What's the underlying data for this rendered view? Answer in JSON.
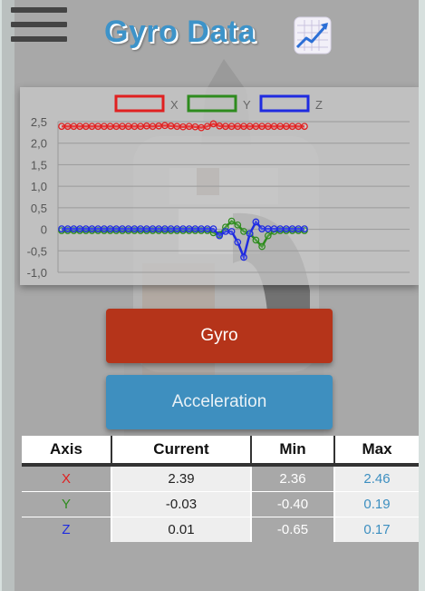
{
  "header": {
    "title": "Gyro Data",
    "menu_icon": "hamburger-menu-icon",
    "title_icon": "chart-increasing-icon"
  },
  "chart_data": {
    "type": "line",
    "x": [
      1,
      2,
      3,
      4,
      5,
      6,
      7,
      8,
      9,
      10,
      11,
      12,
      13,
      14,
      15,
      16,
      17,
      18,
      19,
      20,
      21,
      22,
      23,
      24,
      25,
      26,
      27,
      28,
      29,
      30,
      31,
      32,
      33,
      34,
      35,
      36,
      37,
      38,
      39,
      40,
      41
    ],
    "series": [
      {
        "name": "X",
        "color": "#e02020",
        "values": [
          2.39,
          2.39,
          2.39,
          2.39,
          2.39,
          2.39,
          2.39,
          2.39,
          2.39,
          2.39,
          2.39,
          2.39,
          2.39,
          2.39,
          2.4,
          2.39,
          2.4,
          2.41,
          2.4,
          2.39,
          2.38,
          2.39,
          2.38,
          2.36,
          2.39,
          2.45,
          2.4,
          2.39,
          2.39,
          2.39,
          2.39,
          2.39,
          2.39,
          2.39,
          2.39,
          2.39,
          2.39,
          2.39,
          2.39,
          2.39,
          2.39
        ]
      },
      {
        "name": "Y",
        "color": "#2e8b1e",
        "values": [
          -0.03,
          -0.03,
          -0.03,
          -0.03,
          -0.03,
          -0.03,
          -0.03,
          -0.03,
          -0.03,
          -0.03,
          -0.03,
          -0.03,
          -0.03,
          -0.03,
          -0.03,
          -0.03,
          -0.03,
          -0.03,
          -0.03,
          -0.03,
          -0.03,
          -0.03,
          -0.03,
          -0.03,
          -0.03,
          -0.08,
          -0.12,
          0.05,
          0.19,
          0.1,
          -0.05,
          -0.1,
          -0.25,
          -0.4,
          -0.15,
          -0.05,
          -0.03,
          -0.03,
          -0.03,
          -0.03,
          -0.03
        ]
      },
      {
        "name": "Z",
        "color": "#1f2be0",
        "values": [
          0.01,
          0.01,
          0.01,
          0.01,
          0.01,
          0.01,
          0.01,
          0.01,
          0.01,
          0.01,
          0.01,
          0.01,
          0.01,
          0.01,
          0.01,
          0.01,
          0.01,
          0.01,
          0.01,
          0.01,
          0.01,
          0.01,
          0.01,
          0.01,
          0.01,
          0.01,
          -0.15,
          -0.05,
          -0.05,
          -0.3,
          -0.65,
          -0.1,
          0.17,
          0.01,
          0.01,
          0.01,
          0.01,
          0.01,
          0.01,
          0.01,
          0.01
        ]
      }
    ],
    "y_ticks": [
      "2,5",
      "2,0",
      "1,5",
      "1,0",
      "0,5",
      "0",
      "-0,5",
      "-1,0"
    ],
    "ylim": [
      -1.0,
      2.5
    ],
    "legend_position": "top",
    "grid": true
  },
  "buttons": {
    "gyro": "Gyro",
    "acceleration": "Acceleration"
  },
  "table": {
    "headers": [
      "Axis",
      "Current",
      "Min",
      "Max"
    ],
    "rows": [
      {
        "axis": "X",
        "axis_color": "#e02020",
        "current": "2.39",
        "min": "2.36",
        "max": "2.46"
      },
      {
        "axis": "Y",
        "axis_color": "#2e8b1e",
        "current": "-0.03",
        "min": "-0.40",
        "max": "0.19"
      },
      {
        "axis": "Z",
        "axis_color": "#1f2be0",
        "current": "0.01",
        "min": "-0.65",
        "max": "0.17"
      }
    ]
  }
}
